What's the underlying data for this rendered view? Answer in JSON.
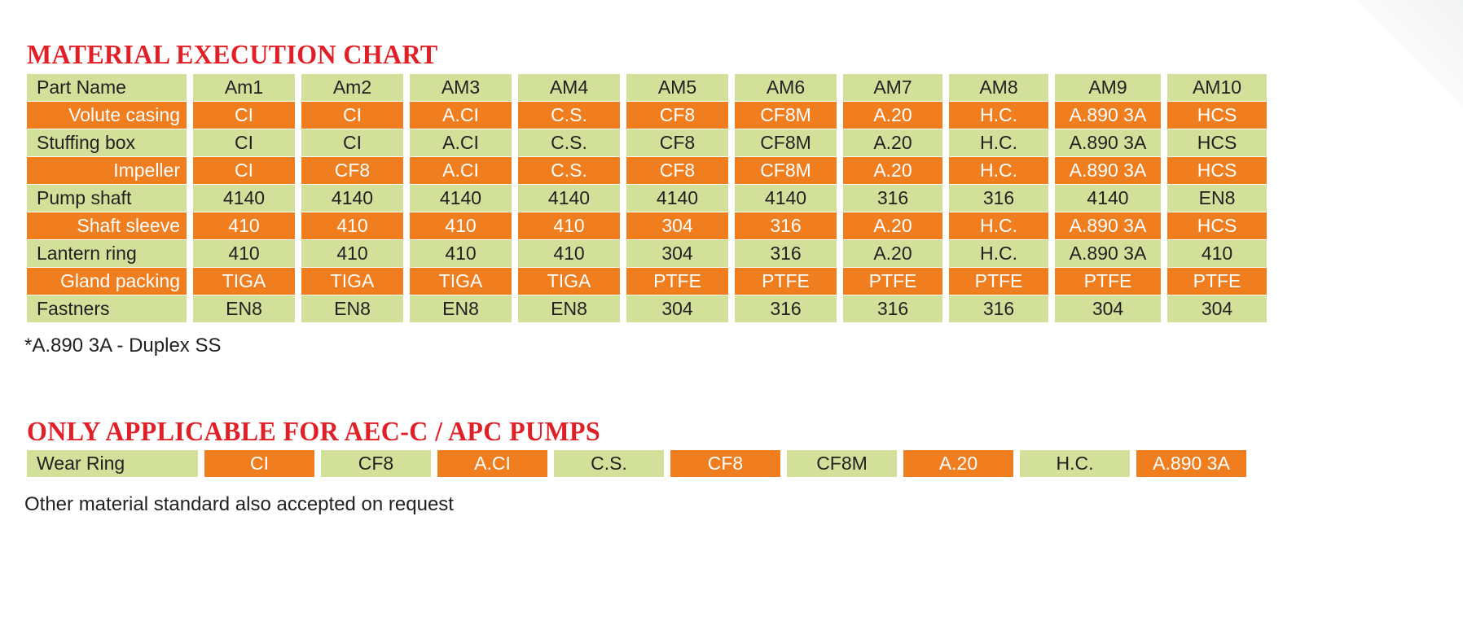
{
  "headings": {
    "material_chart": "MATERIAL EXECUTION CHART",
    "aec_applicable": "ONLY APPLICABLE FOR AEC-C / APC PUMPS"
  },
  "notes": {
    "duplex": "*A.890 3A - Duplex SS",
    "other_material": "Other material standard also accepted on request"
  },
  "colors": {
    "heading_red": "#e01f26",
    "row_green": "#d3e09a",
    "row_orange": "#f07d1e",
    "text_dark": "#231f20",
    "text_light": "#ffffff"
  },
  "material_table": {
    "columns": [
      "Part Name",
      "Am1",
      "Am2",
      "AM3",
      "AM4",
      "AM5",
      "AM6",
      "AM7",
      "AM8",
      "AM9",
      "AM10"
    ],
    "rows": [
      {
        "style": "orange",
        "cells": [
          "Volute casing",
          "CI",
          "CI",
          "A.CI",
          "C.S.",
          "CF8",
          "CF8M",
          "A.20",
          "H.C.",
          "A.890 3A",
          "HCS"
        ]
      },
      {
        "style": "green",
        "cells": [
          "Stuffing box",
          "CI",
          "CI",
          "A.CI",
          "C.S.",
          "CF8",
          "CF8M",
          "A.20",
          "H.C.",
          "A.890 3A",
          "HCS"
        ]
      },
      {
        "style": "orange",
        "cells": [
          "Impeller",
          "CI",
          "CF8",
          "A.CI",
          "C.S.",
          "CF8",
          "CF8M",
          "A.20",
          "H.C.",
          "A.890 3A",
          "HCS"
        ]
      },
      {
        "style": "green",
        "cells": [
          "Pump shaft",
          "4140",
          "4140",
          "4140",
          "4140",
          "4140",
          "4140",
          "316",
          "316",
          "4140",
          "EN8"
        ]
      },
      {
        "style": "orange",
        "cells": [
          "Shaft sleeve",
          "410",
          "410",
          "410",
          "410",
          "304",
          "316",
          "A.20",
          "H.C.",
          "A.890 3A",
          "HCS"
        ]
      },
      {
        "style": "green",
        "cells": [
          "Lantern ring",
          "410",
          "410",
          "410",
          "410",
          "304",
          "316",
          "A.20",
          "H.C.",
          "A.890 3A",
          "410"
        ]
      },
      {
        "style": "orange",
        "cells": [
          "Gland packing",
          "TIGA",
          "TIGA",
          "TIGA",
          "TIGA",
          "PTFE",
          "PTFE",
          "PTFE",
          "PTFE",
          "PTFE",
          "PTFE"
        ]
      },
      {
        "style": "green",
        "cells": [
          "Fastners",
          "EN8",
          "EN8",
          "EN8",
          "EN8",
          "304",
          "316",
          "316",
          "316",
          "304",
          "304"
        ]
      }
    ]
  },
  "wear_ring_table": {
    "row_label": "Wear Ring",
    "cells": [
      {
        "value": "Wear Ring",
        "style": "green",
        "align": "left"
      },
      {
        "value": "CI",
        "style": "orange",
        "align": "center"
      },
      {
        "value": "CF8",
        "style": "green",
        "align": "center"
      },
      {
        "value": "A.CI",
        "style": "orange",
        "align": "center"
      },
      {
        "value": "C.S.",
        "style": "green",
        "align": "center"
      },
      {
        "value": "CF8",
        "style": "orange",
        "align": "center"
      },
      {
        "value": "CF8M",
        "style": "green",
        "align": "center"
      },
      {
        "value": "A.20",
        "style": "orange",
        "align": "center"
      },
      {
        "value": "H.C.",
        "style": "green",
        "align": "center"
      },
      {
        "value": "A.890 3A",
        "style": "orange",
        "align": "center"
      }
    ]
  }
}
